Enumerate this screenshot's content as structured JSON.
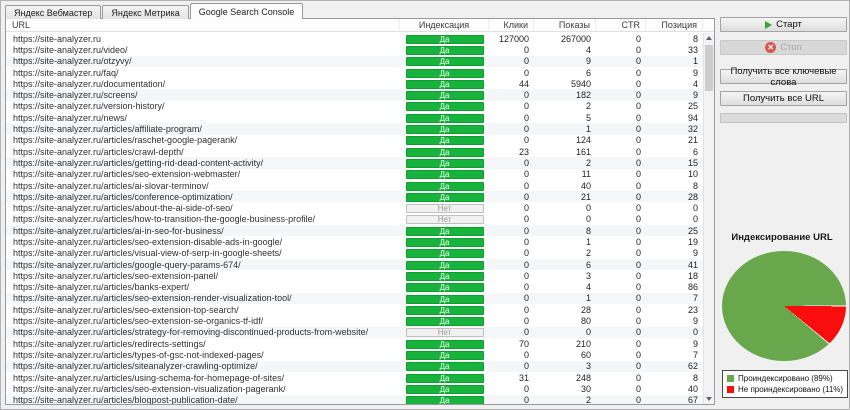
{
  "tabs": [
    {
      "id": "yandex-webmaster",
      "label": "Яндекс Вебмастер",
      "active": false
    },
    {
      "id": "yandex-metrika",
      "label": "Яндекс Метрика",
      "active": false
    },
    {
      "id": "google-search-console",
      "label": "Google Search Console",
      "active": true
    }
  ],
  "table": {
    "columns": [
      "URL",
      "Индексация",
      "Клики",
      "Показы",
      "CTR",
      "Позиция"
    ],
    "rows": [
      {
        "url": "https://site-analyzer.ru",
        "indexed": "Да",
        "clicks": 127000,
        "shows": 267000,
        "ctr": 0,
        "position": 8
      },
      {
        "url": "https://site-analyzer.ru/video/",
        "indexed": "Да",
        "clicks": 0,
        "shows": 4,
        "ctr": 0,
        "position": 33
      },
      {
        "url": "https://site-analyzer.ru/otzyvy/",
        "indexed": "Да",
        "clicks": 0,
        "shows": 9,
        "ctr": 0,
        "position": 1
      },
      {
        "url": "https://site-analyzer.ru/faq/",
        "indexed": "Да",
        "clicks": 0,
        "shows": 6,
        "ctr": 0,
        "position": 9
      },
      {
        "url": "https://site-analyzer.ru/documentation/",
        "indexed": "Да",
        "clicks": 44,
        "shows": 5940,
        "ctr": 0,
        "position": 4
      },
      {
        "url": "https://site-analyzer.ru/screens/",
        "indexed": "Да",
        "clicks": 0,
        "shows": 182,
        "ctr": 0,
        "position": 9
      },
      {
        "url": "https://site-analyzer.ru/version-history/",
        "indexed": "Да",
        "clicks": 0,
        "shows": 2,
        "ctr": 0,
        "position": 25
      },
      {
        "url": "https://site-analyzer.ru/news/",
        "indexed": "Да",
        "clicks": 0,
        "shows": 5,
        "ctr": 0,
        "position": 94
      },
      {
        "url": "https://site-analyzer.ru/articles/affiliate-program/",
        "indexed": "Да",
        "clicks": 0,
        "shows": 1,
        "ctr": 0,
        "position": 32
      },
      {
        "url": "https://site-analyzer.ru/articles/raschet-google-pagerank/",
        "indexed": "Да",
        "clicks": 0,
        "shows": 124,
        "ctr": 0,
        "position": 21
      },
      {
        "url": "https://site-analyzer.ru/articles/crawl-depth/",
        "indexed": "Да",
        "clicks": 23,
        "shows": 161,
        "ctr": 0,
        "position": 6
      },
      {
        "url": "https://site-analyzer.ru/articles/getting-rid-dead-content-activity/",
        "indexed": "Да",
        "clicks": 0,
        "shows": 2,
        "ctr": 0,
        "position": 15
      },
      {
        "url": "https://site-analyzer.ru/articles/seo-extension-webmaster/",
        "indexed": "Да",
        "clicks": 0,
        "shows": 11,
        "ctr": 0,
        "position": 10
      },
      {
        "url": "https://site-analyzer.ru/articles/ai-slovar-terminov/",
        "indexed": "Да",
        "clicks": 0,
        "shows": 40,
        "ctr": 0,
        "position": 8
      },
      {
        "url": "https://site-analyzer.ru/articles/conference-optimization/",
        "indexed": "Да",
        "clicks": 0,
        "shows": 21,
        "ctr": 0,
        "position": 28
      },
      {
        "url": "https://site-analyzer.ru/articles/about-the-ai-side-of-seo/",
        "indexed": "Нет",
        "clicks": 0,
        "shows": 0,
        "ctr": 0,
        "position": 0
      },
      {
        "url": "https://site-analyzer.ru/articles/how-to-transition-the-google-business-profile/",
        "indexed": "Нет",
        "clicks": 0,
        "shows": 0,
        "ctr": 0,
        "position": 0
      },
      {
        "url": "https://site-analyzer.ru/articles/ai-in-seo-for-business/",
        "indexed": "Да",
        "clicks": 0,
        "shows": 8,
        "ctr": 0,
        "position": 25
      },
      {
        "url": "https://site-analyzer.ru/articles/seo-extension-disable-ads-in-google/",
        "indexed": "Да",
        "clicks": 0,
        "shows": 1,
        "ctr": 0,
        "position": 19
      },
      {
        "url": "https://site-analyzer.ru/articles/visual-view-of-serp-in-google-sheets/",
        "indexed": "Да",
        "clicks": 0,
        "shows": 2,
        "ctr": 0,
        "position": 9
      },
      {
        "url": "https://site-analyzer.ru/articles/google-query-params-674/",
        "indexed": "Да",
        "clicks": 0,
        "shows": 6,
        "ctr": 0,
        "position": 41
      },
      {
        "url": "https://site-analyzer.ru/articles/seo-extension-panel/",
        "indexed": "Да",
        "clicks": 0,
        "shows": 3,
        "ctr": 0,
        "position": 18
      },
      {
        "url": "https://site-analyzer.ru/articles/banks-expert/",
        "indexed": "Да",
        "clicks": 0,
        "shows": 4,
        "ctr": 0,
        "position": 86
      },
      {
        "url": "https://site-analyzer.ru/articles/seo-extension-render-visualization-tool/",
        "indexed": "Да",
        "clicks": 0,
        "shows": 1,
        "ctr": 0,
        "position": 7
      },
      {
        "url": "https://site-analyzer.ru/articles/seo-extension-top-search/",
        "indexed": "Да",
        "clicks": 0,
        "shows": 28,
        "ctr": 0,
        "position": 23
      },
      {
        "url": "https://site-analyzer.ru/articles/seo-extension-se-organics-tf-idf/",
        "indexed": "Да",
        "clicks": 0,
        "shows": 80,
        "ctr": 0,
        "position": 9
      },
      {
        "url": "https://site-analyzer.ru/articles/strategy-for-removing-discontinued-products-from-website/",
        "indexed": "Нет",
        "clicks": 0,
        "shows": 0,
        "ctr": 0,
        "position": 0
      },
      {
        "url": "https://site-analyzer.ru/articles/redirects-settings/",
        "indexed": "Да",
        "clicks": 70,
        "shows": 210,
        "ctr": 0,
        "position": 9
      },
      {
        "url": "https://site-analyzer.ru/articles/types-of-gsc-not-indexed-pages/",
        "indexed": "Да",
        "clicks": 0,
        "shows": 60,
        "ctr": 0,
        "position": 7
      },
      {
        "url": "https://site-analyzer.ru/articles/siteanalyzer-crawling-optimize/",
        "indexed": "Да",
        "clicks": 0,
        "shows": 3,
        "ctr": 0,
        "position": 62
      },
      {
        "url": "https://site-analyzer.ru/articles/using-schema-for-homepage-of-sites/",
        "indexed": "Да",
        "clicks": 31,
        "shows": 248,
        "ctr": 0,
        "position": 8
      },
      {
        "url": "https://site-analyzer.ru/articles/seo-extension-visualization-pagerank/",
        "indexed": "Да",
        "clicks": 0,
        "shows": 30,
        "ctr": 0,
        "position": 40
      },
      {
        "url": "https://site-analyzer.ru/articles/blogpost-publication-date/",
        "indexed": "Да",
        "clicks": 0,
        "shows": 2,
        "ctr": 0,
        "position": 67
      }
    ]
  },
  "buttons": {
    "start": "Старт",
    "stop": "Стоп",
    "get_keywords": "Получить все ключевые слова",
    "get_urls": "Получить все URL"
  },
  "chart_data": {
    "type": "pie",
    "title": "Индексирование URL",
    "legend_position": "bottom",
    "slices": [
      {
        "label": "Проиндексировано (89%)",
        "value": 89,
        "color": "#69a74d"
      },
      {
        "label": "Не проиндексировано (11%)",
        "value": 11,
        "color": "#fa0d0d"
      }
    ]
  },
  "colors": {
    "badge_yes": "#17b33c",
    "badge_no": "#f1f1f1",
    "pie_green": "#69a74d",
    "pie_red": "#fa0d0d",
    "window_bg": "#f0f0f0"
  }
}
